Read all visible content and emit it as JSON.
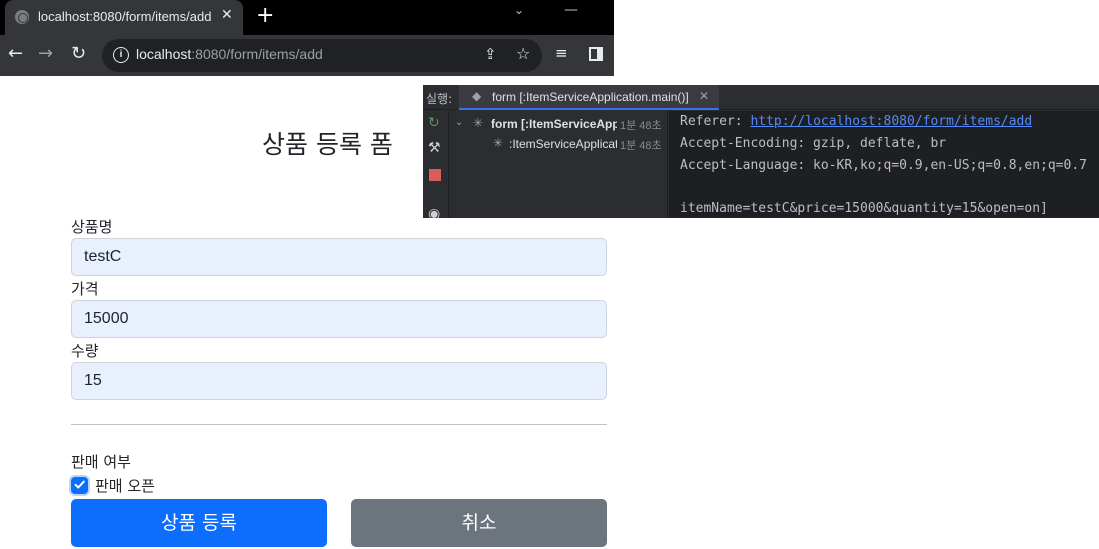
{
  "browser": {
    "tab_title": "localhost:8080/form/items/add",
    "tab_close": "✕",
    "new_tab": "+",
    "url_host": "localhost",
    "url_rest": ":8080/form/items/add"
  },
  "page": {
    "title": "상품 등록 폼",
    "fields": [
      {
        "label": "상품명",
        "value": "testC"
      },
      {
        "label": "가격",
        "value": "15000"
      },
      {
        "label": "수량",
        "value": "15"
      }
    ],
    "sale_section_label": "판매 여부",
    "open_checkbox": {
      "label": "판매 오픈",
      "checked": true
    },
    "submit_label": "상품 등록",
    "cancel_label": "취소"
  },
  "ide": {
    "run_label": "실행:",
    "tab_title": "form [:ItemServiceApplication.main()]",
    "tab_close": "✕",
    "tree": [
      {
        "text": "form [:ItemServiceApp",
        "time": "1분 48초"
      },
      {
        "text": ":ItemServiceApplicat",
        "time": "1분 48초"
      }
    ],
    "console": {
      "referer_label": "Referer: ",
      "referer_url": "http://localhost:8080/form/items/add",
      "accept_encoding": "Accept-Encoding: gzip, deflate, br",
      "accept_language": "Accept-Language: ko-KR,ko;q=0.9,en-US;q=0.8,en;q=0.7",
      "body": "itemName=testC&price=15000&quantity=15&open=on]"
    }
  },
  "colors": {
    "primary": "#0d6efd",
    "secondary": "#6c757d",
    "autofill_bg": "#e8f0fe",
    "console_link": "#548af7"
  }
}
